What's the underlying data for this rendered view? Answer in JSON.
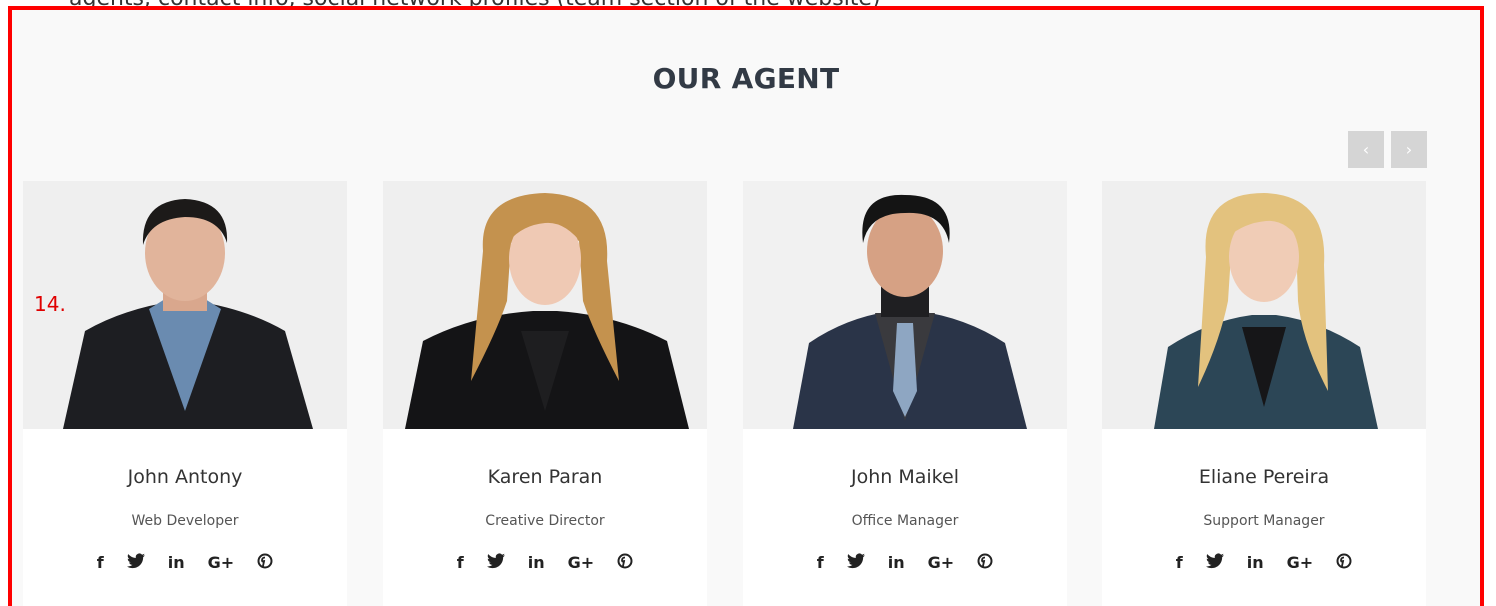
{
  "annotation": "14.",
  "header_cut_text": "— agents, contact info, social network profiles (team section of the website)",
  "section": {
    "title": "OUR AGENT"
  },
  "carousel": {
    "prev_label": "‹",
    "next_label": "›"
  },
  "social_icons": [
    "facebook-icon",
    "twitter-icon",
    "linkedin-icon",
    "google-plus-icon",
    "pinterest-icon"
  ],
  "social_labels": {
    "facebook": "f",
    "linkedin": "in",
    "google_plus": "G+"
  },
  "agents": [
    {
      "name": "John Antony",
      "role": "Web Developer"
    },
    {
      "name": "Karen Paran",
      "role": "Creative Director"
    },
    {
      "name": "John Maikel",
      "role": "Office Manager"
    },
    {
      "name": "Eliane Pereira",
      "role": "Support Manager"
    }
  ],
  "colors": {
    "frame": "#ff0000",
    "background": "#f9f9f9",
    "title": "#323a45",
    "nav": "#d5d5d5",
    "annotation": "#e00000"
  }
}
